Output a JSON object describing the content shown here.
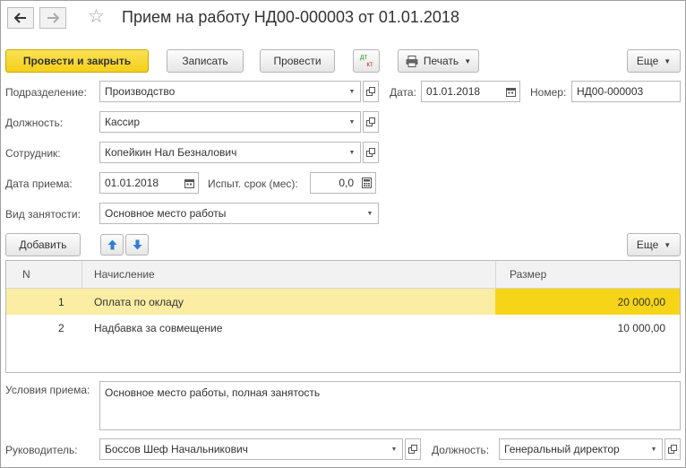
{
  "title": "Прием на работу НД00-000003 от 01.01.2018",
  "toolbar": {
    "post_close": "Провести и закрыть",
    "save": "Записать",
    "post": "Провести",
    "dtkt_top": "дт",
    "dtkt_bottom": "кт",
    "print": "Печать",
    "more": "Еще"
  },
  "form": {
    "department_label": "Подразделение:",
    "department_value": "Производство",
    "date_label": "Дата:",
    "date_value": "01.01.2018",
    "number_label": "Номер:",
    "number_value": "НД00-000003",
    "position_label": "Должность:",
    "position_value": "Кассир",
    "employee_label": "Сотрудник:",
    "employee_value": "Копейкин Нал Безналович",
    "hire_date_label": "Дата приема:",
    "hire_date_value": "01.01.2018",
    "trial_label": "Испыт. срок (мес):",
    "trial_value": "0,0",
    "employment_label": "Вид занятости:",
    "employment_value": "Основное место работы"
  },
  "table_toolbar": {
    "add": "Добавить",
    "more": "Еще"
  },
  "table": {
    "columns": [
      "N",
      "Начисление",
      "Размер"
    ],
    "rows": [
      {
        "n": "1",
        "accrual": "Оплата по окладу",
        "amount": "20 000,00"
      },
      {
        "n": "2",
        "accrual": "Надбавка за совмещение",
        "amount": "10 000,00"
      }
    ]
  },
  "conditions": {
    "label": "Условия приема:",
    "value": "Основное место работы, полная занятость"
  },
  "footer": {
    "manager_label": "Руководитель:",
    "manager_value": "Боссов Шеф Начальникович",
    "manager_position_label": "Должность:",
    "manager_position_value": "Генеральный директор"
  },
  "colors": {
    "primary_button": "#f5cf1a",
    "selected_row": "#fbeda3",
    "selected_cell": "#f6d518",
    "arrow_blue": "#2f7fd0"
  }
}
